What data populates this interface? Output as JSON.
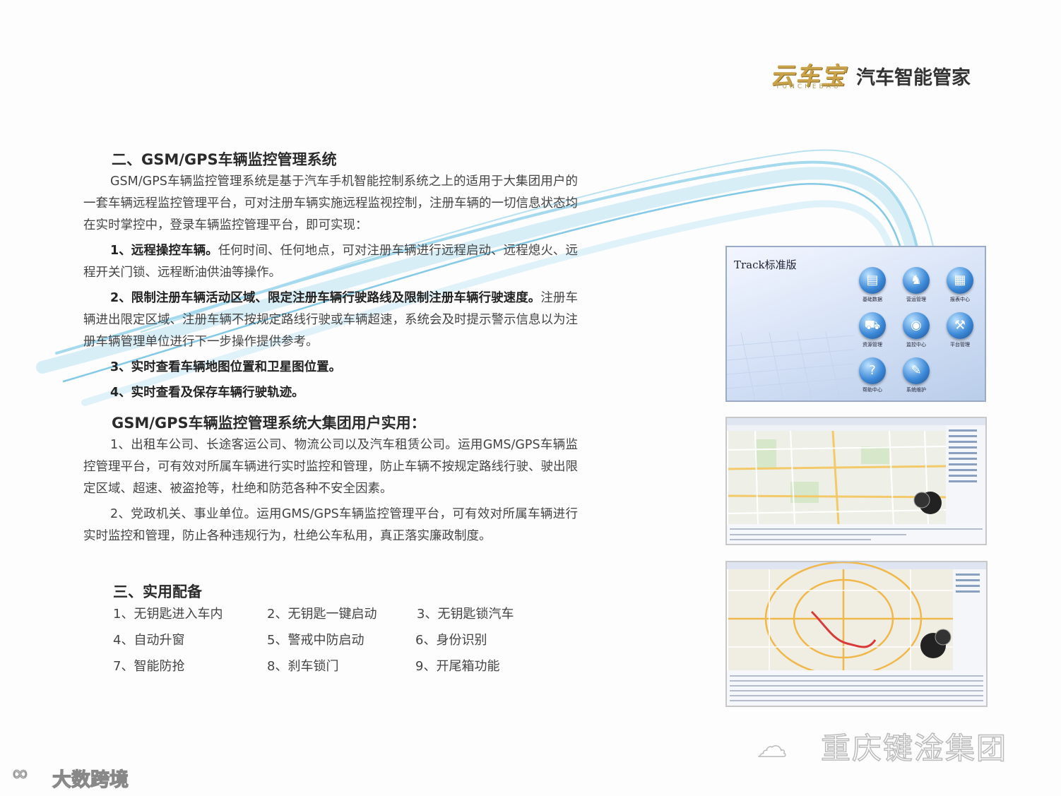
{
  "brand": {
    "logo": "云车宝",
    "pinyin": "YUNCHEBAO",
    "title": "汽车智能管家"
  },
  "section2": {
    "heading": "二、GSM/GPS车辆监控管理系统",
    "intro": "GSM/GPS车辆监控管理系统是基于汽车手机智能控制系统之上的适用于大集团用户的一套车辆远程监控管理平台，可对注册车辆实施远程监视控制，注册车辆的一切信息状态均在实时掌控中，登录车辆监控管理平台，即可实现：",
    "items": [
      {
        "title": "1、远程操控车辆。",
        "text": "任何时间、任何地点，可对注册车辆进行远程启动、远程熄火、远程开关门锁、远程断油供油等操作。"
      },
      {
        "title": "2、限制注册车辆活动区域、限定注册车辆行驶路线及限制注册车辆行驶速度。",
        "text": "注册车辆进出限定区域、注册车辆不按规定路线行驶或车辆超速，系统会及时提示警示信息以为注册车辆管理单位进行下一步操作提供参考。"
      },
      {
        "title": "3、实时查看车辆地图位置和卫星图位置。",
        "text": ""
      },
      {
        "title": "4、实时查看及保存车辆行驶轨迹。",
        "text": ""
      }
    ]
  },
  "usage": {
    "heading": "GSM/GPS车辆监控管理系统大集团用户实用：",
    "p1": "1、出租车公司、长途客运公司、物流公司以及汽车租赁公司。运用GMS/GPS车辆监控管理平台，可有效对所属车辆进行实时监控和管理，防止车辆不按规定路线行驶、驶出限定区域、超速、被盗抢等，杜绝和防范各种不安全因素。",
    "p2": "2、党政机关、事业单位。运用GMS/GPS车辆监控管理平台，可有效对所属车辆进行实时监控和管理，防止各种违规行为，杜绝公车私用，真正落实廉政制度。"
  },
  "section3": {
    "heading": "三、实用配备",
    "features": [
      "1、无钥匙进入车内",
      "2、无钥匙一键启动",
      "3、无钥匙锁汽车",
      "4、自动升窗",
      "5、警戒中防启动",
      "6、身份识别",
      "7、智能防抢",
      "8、刹车锁门",
      "9、开尾箱功能"
    ]
  },
  "screenshot1": {
    "title": "Track标准版",
    "tiles": [
      "基础数据",
      "营运管理",
      "报表中心",
      "资源管理",
      "监控中心",
      "平台管理",
      "帮助中心",
      "系统维护"
    ]
  },
  "watermark": {
    "text": "重庆键淦集团"
  },
  "corner": {
    "text": "大数跨境"
  },
  "colors": {
    "swoosh": "#7fc6e6",
    "tile": "#3d8ad8",
    "brand_gold": "#c9a24a"
  }
}
